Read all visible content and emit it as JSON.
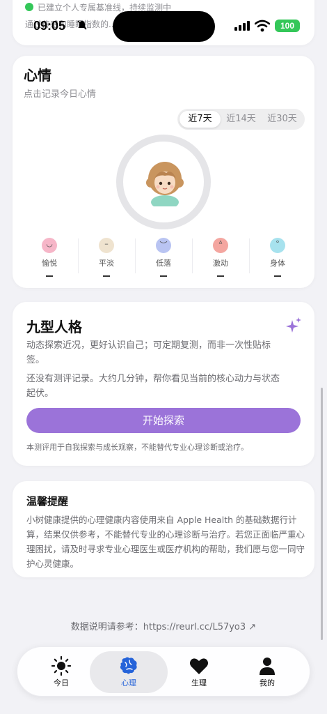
{
  "top_card": {
    "line1": "已建立个人专属基准线，持续监测中",
    "line2": "通过传感和睡眠指数的..."
  },
  "status_bar": {
    "time": "09:05",
    "battery": "100"
  },
  "mood": {
    "title": "心情",
    "subtitle": "点击记录今日心情",
    "ranges": [
      "近7天",
      "近14天",
      "近30天"
    ],
    "selected_range": "近7天",
    "moods": [
      {
        "label": "愉悦",
        "value": "—",
        "color": "#f6b6c8"
      },
      {
        "label": "平淡",
        "value": "—",
        "color": "#efe3cf"
      },
      {
        "label": "低落",
        "value": "—",
        "color": "#b9c4f2"
      },
      {
        "label": "激动",
        "value": "—",
        "color": "#f4a6a0"
      },
      {
        "label": "身体",
        "value": "—",
        "color": "#a7e2ee"
      }
    ]
  },
  "enneagram": {
    "title": "九型人格",
    "desc": "动态探索近况，更好认识自己；可定期复测，而非一次性贴标签。",
    "empty": "还没有测评记录。大约几分钟，帮你看见当前的核心动力与状态起伏。",
    "cta": "开始探索",
    "note": "本测评用于自我探索与成长观察，不能替代专业心理诊断或治疗。"
  },
  "tip": {
    "title": "温馨提醒",
    "body": "小树健康提供的心理健康内容使用来自 Apple Health 的基础数据行计算，结果仅供参考，不能替代专业的心理诊断与治疗。若您正面临严重心理困扰，请及时寻求专业心理医生或医疗机构的帮助，我们愿与您一同守护心灵健康。"
  },
  "source": "数据说明请参考：https://reurl.cc/L57yo3 ↗",
  "tabs": [
    {
      "label": "今日",
      "icon": "sun-icon"
    },
    {
      "label": "心理",
      "icon": "brain-icon"
    },
    {
      "label": "生理",
      "icon": "heart-icon"
    },
    {
      "label": "我的",
      "icon": "person-icon"
    }
  ],
  "active_tab": "心理",
  "colors": {
    "accent": "#9b73d9",
    "tab_active": "#2563d9",
    "battery": "#34c759"
  }
}
